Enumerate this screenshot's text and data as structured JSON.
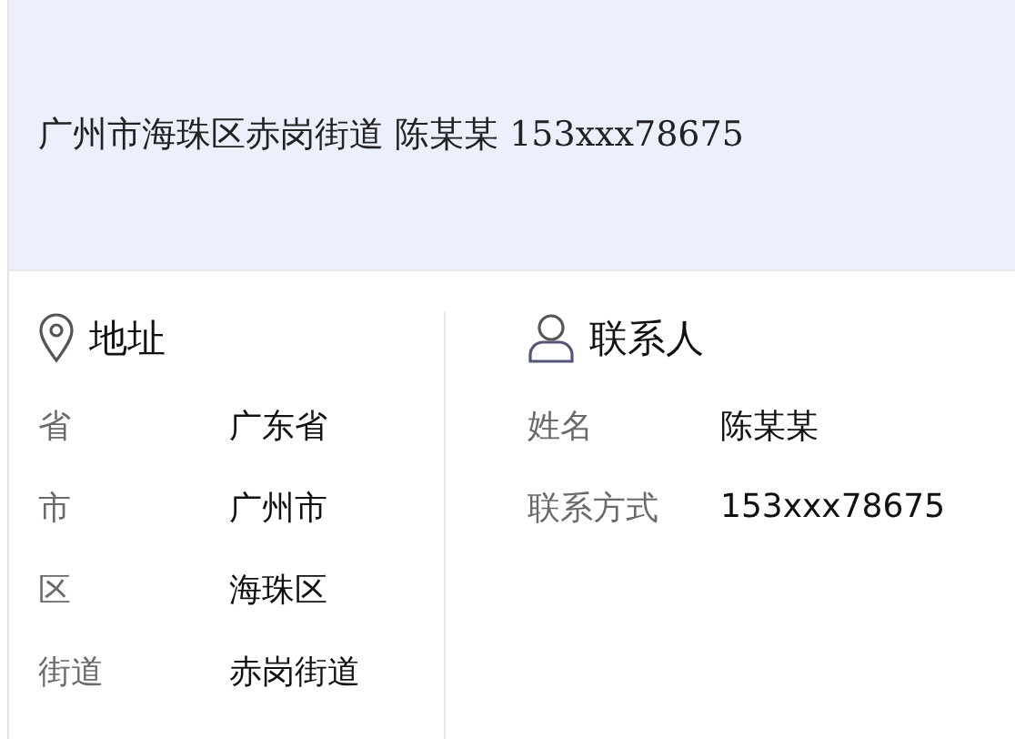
{
  "summary": "广州市海珠区赤岗街道 陈某某 153xxx78675",
  "sections": [
    {
      "kind": "address",
      "title": "地址",
      "fields": [
        {
          "label": "省",
          "value": "广东省"
        },
        {
          "label": "市",
          "value": "广州市"
        },
        {
          "label": "区",
          "value": "海珠区"
        },
        {
          "label": "街道",
          "value": "赤岗街道"
        }
      ]
    },
    {
      "kind": "contact",
      "title": "联系人",
      "fields": [
        {
          "label": "姓名",
          "value": "陈某某"
        },
        {
          "label": "联系方式",
          "value": "153xxx78675"
        }
      ]
    }
  ]
}
